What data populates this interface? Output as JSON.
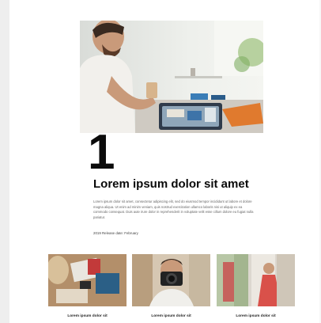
{
  "feature": {
    "number": "1",
    "title": "Lorem ipsum dolor sit amet",
    "body": "Lorem ipsum dolor sit amet, consectetur adipiscing elit, sed do eiusmod tempor incididunt ut labore et dolore magna aliqua. Ut enim ad minim veniam, quis nostrud exercitation ullamco laboris nisi ut aliquip ex ea commodo consequat. Duis aute irure dolor in reprehenderit in voluptate velit esse cillum dolore eu fugiat nulla pariatur.",
    "release": "2019 Release date: February"
  },
  "related": [
    {
      "caption": "Lorem ipsum dolor sit"
    },
    {
      "caption": "Lorem ipsum dolor sit"
    },
    {
      "caption": "Lorem ipsum dolor sit"
    }
  ]
}
